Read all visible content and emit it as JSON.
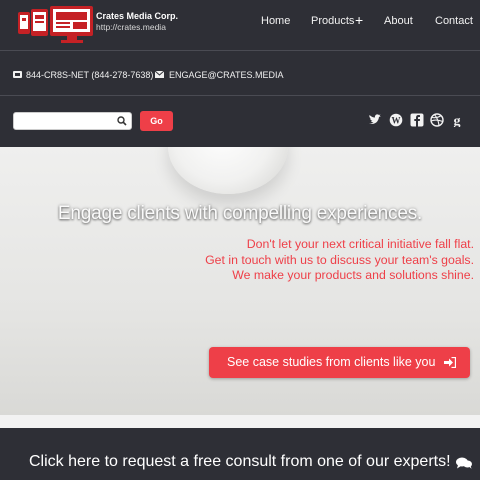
{
  "brand": {
    "name": "Crates Media Corp.",
    "url": "http://crates.media",
    "logo_icon": "monitor-devices-logo",
    "accent": "#ee3f48"
  },
  "nav": {
    "items": [
      {
        "label": "Home"
      },
      {
        "label": "Products",
        "expand_icon": "plus"
      },
      {
        "label": "About"
      },
      {
        "label": "Contact"
      }
    ]
  },
  "contact": {
    "phone": "844-CR8S-NET (844-278-7638)",
    "phone_icon": "phone-icon",
    "email": "ENGAGE@CRATES.MEDIA",
    "email_icon": "envelope-icon"
  },
  "search": {
    "value": "",
    "placeholder": "",
    "button": "Go"
  },
  "social": {
    "icons": [
      "twitter-icon",
      "wordpress-icon",
      "facebook-icon",
      "dribbble-icon",
      "google-icon"
    ]
  },
  "hero": {
    "headline": "Engage clients with compelling experiences.",
    "tagline": [
      "Don't let your next critical initiative fall flat.",
      "Get in touch with us to discuss your team's goals.",
      "We make your products and solutions shine."
    ],
    "cta": "See case studies from clients like you",
    "cta_icon": "sign-in-icon"
  },
  "footer": {
    "consult": "Click here to request a free consult from one of our experts!",
    "consult_icon": "comments-icon"
  },
  "colors": {
    "dark": "#2e2f36",
    "accent": "#ee3f48"
  }
}
